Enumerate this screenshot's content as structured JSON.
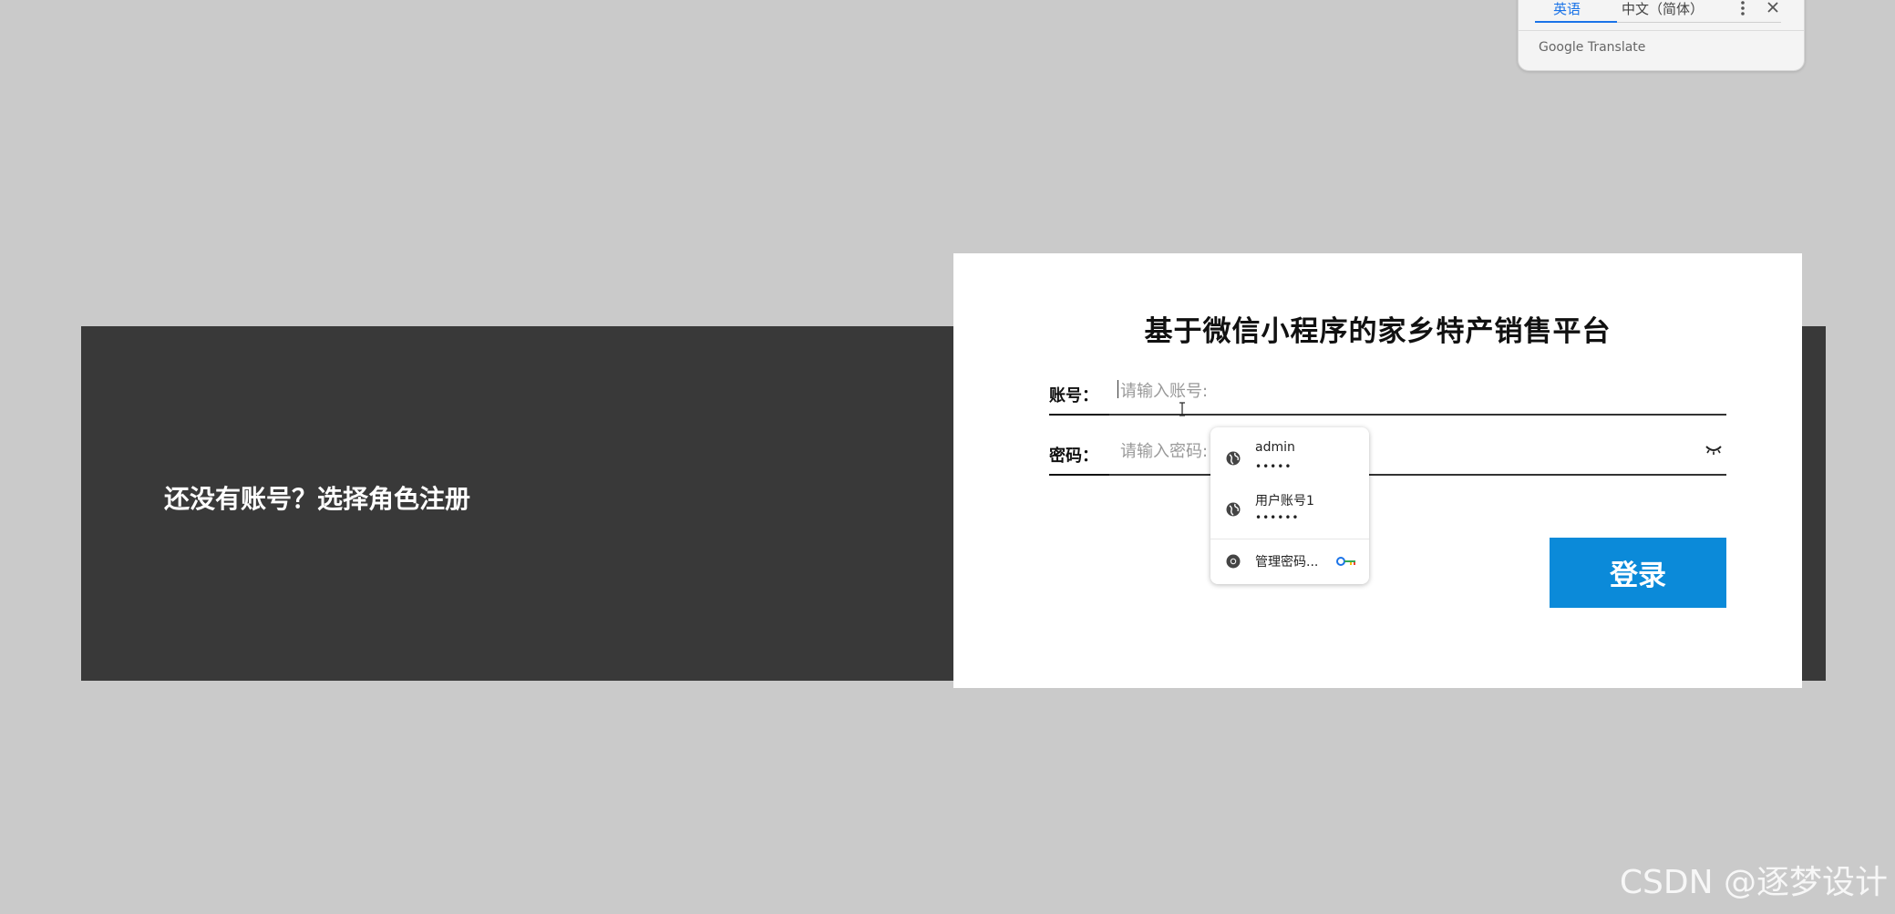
{
  "banner": {
    "register_prompt": "还没有账号？选择角色注册"
  },
  "login": {
    "title": "基于微信小程序的家乡特产销售平台",
    "account_label": "账号：",
    "account_placeholder": "请输入账号:",
    "account_value": "",
    "password_label": "密码：",
    "password_placeholder": "请输入密码:",
    "password_value": "",
    "submit_label": "登录",
    "button_color": "#0b8ad9"
  },
  "autofill": {
    "items": [
      {
        "username": "admin",
        "password_mask": "•••••"
      },
      {
        "username": "用户账号1",
        "password_mask": "••••••"
      }
    ],
    "manage_label": "管理密码..."
  },
  "translate": {
    "tab_source": "英语",
    "tab_target": "中文（简体）",
    "brand": "Google Translate"
  },
  "watermark": "CSDN @逐梦设计"
}
